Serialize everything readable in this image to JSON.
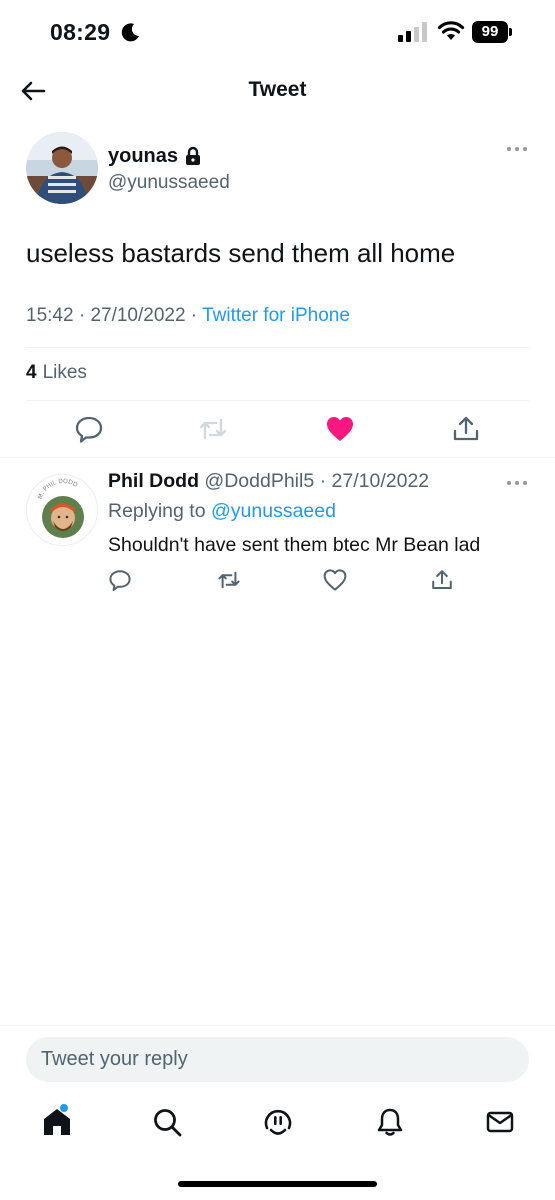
{
  "status_bar": {
    "time": "08:29",
    "battery": "99"
  },
  "header": {
    "title": "Tweet"
  },
  "tweet": {
    "author_name": "younas",
    "author_handle": "@yunussaeed",
    "text": "useless bastards send them all home",
    "time": "15:42",
    "date": "27/10/2022",
    "source": "Twitter for iPhone",
    "likes_count": "4",
    "likes_label": "Likes",
    "liked": true
  },
  "reply": {
    "author_name": "Phil Dodd",
    "author_handle": "@DoddPhil5",
    "date": "27/10/2022",
    "replying_prefix": "Replying to",
    "replying_to": "@yunussaeed",
    "text": "Shouldn't have sent them btec Mr Bean lad",
    "avatar_caption": "M. PHIL DODD"
  },
  "compose": {
    "placeholder": "Tweet your reply"
  },
  "tabbar": {
    "items": [
      "home-icon",
      "search-icon",
      "spaces-icon",
      "notifications-icon",
      "messages-icon"
    ]
  },
  "colors": {
    "accent": "#1d9bf0",
    "like": "#f91880",
    "muted": "#536471"
  }
}
